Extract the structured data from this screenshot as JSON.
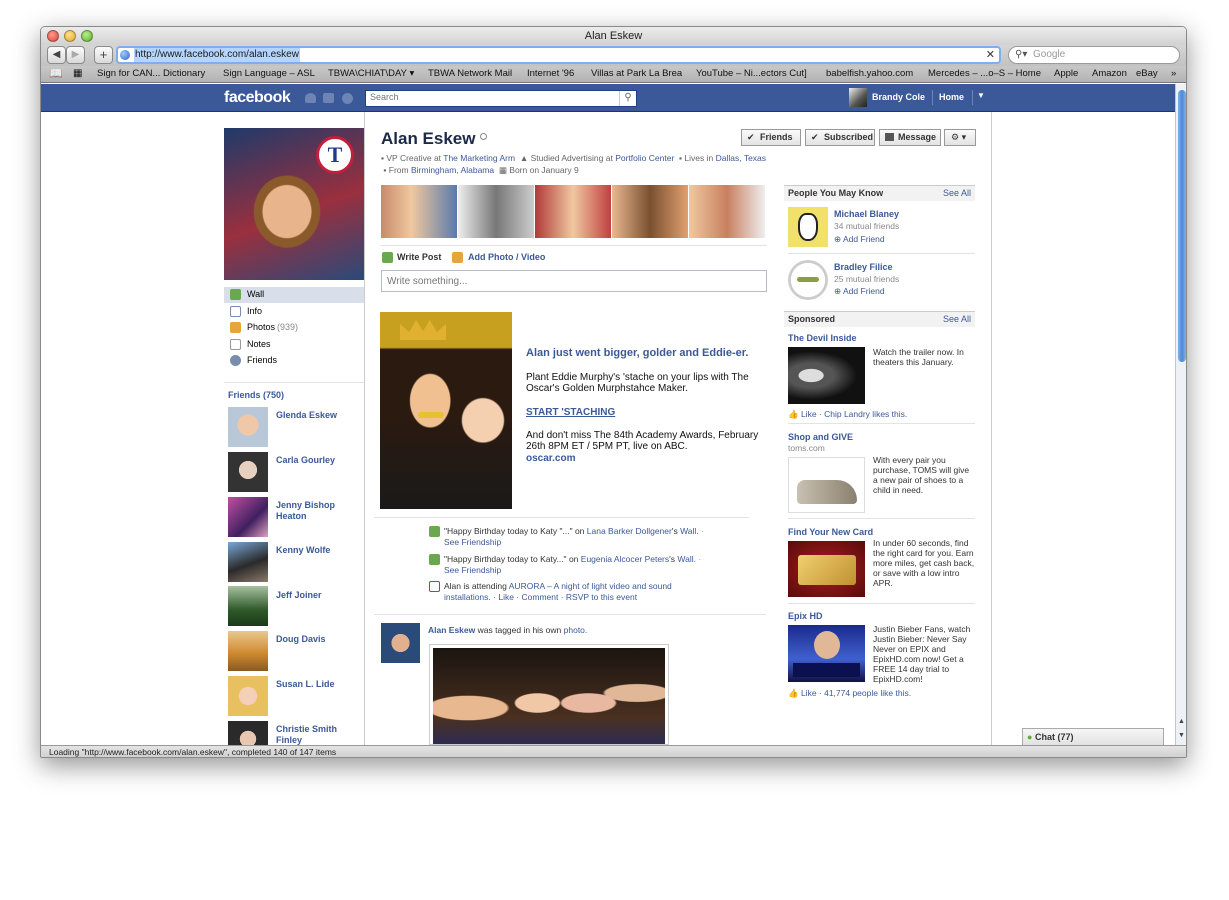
{
  "window": {
    "title": "Alan Eskew",
    "url": "http://www.facebook.com/alan.eskew",
    "search_placeholder": "Google",
    "nav_add": "+",
    "close_glyph": "✕",
    "status": "Loading \"http://www.facebook.com/alan.eskew\", completed 140 of 147 items"
  },
  "bookmarks": [
    "Sign for CAN... Dictionary",
    "Sign Language – ASL",
    "TBWA\\CHIAT\\DAY ▾",
    "TBWA Network Mail",
    "Internet '96",
    "Villas at Park La Brea",
    "YouTube – Ni...ectors Cut]",
    "babelfish.yahoo.com",
    "Mercedes – ...o–S – Home",
    "Apple",
    "Amazon",
    "eBay",
    "»"
  ],
  "fbbar": {
    "logo": "facebook",
    "search_placeholder": "Search",
    "user": "Brandy Cole",
    "home": "Home"
  },
  "profile": {
    "name": "Alan Eskew",
    "info_1": "VP Creative at",
    "info_1_link": "The Marketing Arm",
    "info_2": "Studied Advertising at",
    "info_2_link": "Portfolio Center",
    "info_3": "Lives",
    "info_4": "in",
    "info_4_link": "Dallas, Texas",
    "info_5": "From",
    "info_5_link": "Birmingham, Alabama",
    "info_6": "Born on January 9",
    "buttons": {
      "friends": "Friends",
      "subscribed": "Subscribed",
      "message": "Message"
    }
  },
  "left_nav": [
    {
      "label": "Wall",
      "count": ""
    },
    {
      "label": "Info",
      "count": ""
    },
    {
      "label": "Photos",
      "count": "(939)"
    },
    {
      "label": "Notes",
      "count": ""
    },
    {
      "label": "Friends",
      "count": ""
    }
  ],
  "friends_header": "Friends (750)",
  "friends": [
    {
      "name": "Glenda Eskew"
    },
    {
      "name": "Carla Gourley"
    },
    {
      "name": "Jenny Bishop Heaton"
    },
    {
      "name": "Kenny Wolfe"
    },
    {
      "name": "Jeff Joiner"
    },
    {
      "name": "Doug Davis"
    },
    {
      "name": "Susan L. Lide"
    },
    {
      "name": "Christie Smith Finley"
    }
  ],
  "composer": {
    "write_post": "Write Post",
    "add_photo": "Add Photo / Video",
    "placeholder": "Write something..."
  },
  "promo": {
    "headline": "Alan just went bigger, golder and Eddie-er.",
    "body": "Plant Eddie Murphy's 'stache on your lips with The Oscar's Golden Murphstahce Maker.",
    "cta": "START 'STACHING",
    "footer": "And don't miss The 84th Academy Awards, February 26th 8PM ET / 5PM PT, live on ABC.",
    "link": "oscar.com"
  },
  "activity": [
    {
      "pre": "\"Happy Birthday today to Katy \"...\" on",
      "link": "Lana Barker Dollgener",
      "post": "'s",
      "link2": "Wall.",
      "tail": "·",
      "line2": "See Friendship"
    },
    {
      "pre": "\"Happy Birthday today to Katy...\" on",
      "link": "Eugenia Alcocer Peters",
      "post": "'s",
      "link2": "Wall.",
      "tail": "·",
      "line2": "See Friendship"
    },
    {
      "pre": "Alan is attending",
      "link": "AURORA – A night of light video and sound",
      "line2_link": "installations.",
      "line2": "· Like · Comment · RSVP to this event"
    }
  ],
  "tag_story": {
    "name": "Alan Eskew",
    "text": "was tagged in his own",
    "link": "photo."
  },
  "pymk": {
    "header": "People You May Know",
    "see_all": "See All",
    "people": [
      {
        "name": "Michael Blaney",
        "mutual": "34 mutual friends",
        "action": "Add Friend"
      },
      {
        "name": "Bradley Filice",
        "mutual": "25 mutual friends",
        "action": "Add Friend"
      }
    ]
  },
  "sponsored": {
    "header": "Sponsored",
    "see_all": "See All",
    "ads": [
      {
        "title": "The Devil Inside",
        "sub": "",
        "body": "Watch the trailer now. In theaters this January.",
        "social": "Like · Chip Landry likes this."
      },
      {
        "title": "Shop and GIVE",
        "sub": "toms.com",
        "body": "With every pair you purchase, TOMS will give a new pair of shoes to a child in need.",
        "social": ""
      },
      {
        "title": "Find Your New Card",
        "sub": "",
        "body": "In under 60 seconds, find the right card for you. Earn more miles, get cash back, or save with a low intro APR.",
        "social": ""
      },
      {
        "title": "Epix HD",
        "sub": "",
        "body": "Justin Bieber Fans, watch Justin Bieber: Never Say Never on EPIX and EpixHD.com now! Get a FREE 14 day trial to EpixHD.com!",
        "social": "Like · 41,774 people like this."
      }
    ]
  },
  "chat": "Chat (77)",
  "colors": {
    "fb_blue": "#3b5998",
    "link": "#3b5998"
  }
}
